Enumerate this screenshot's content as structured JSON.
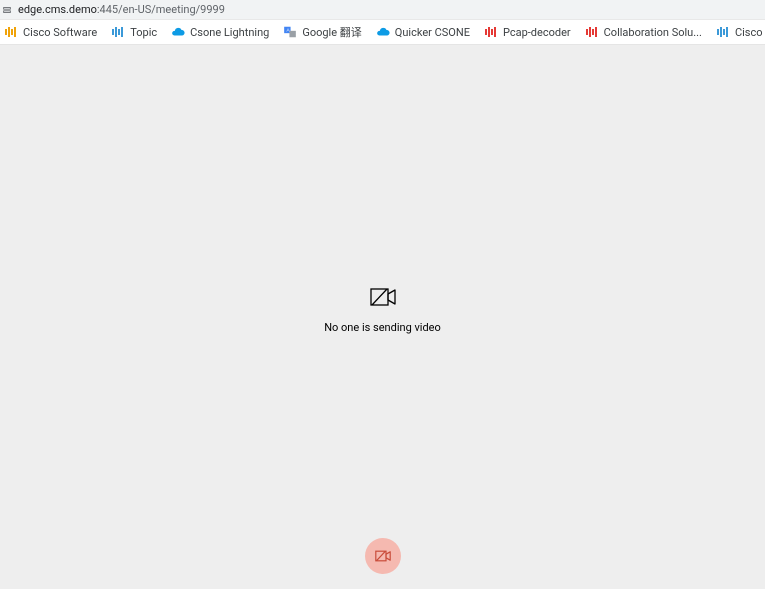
{
  "address": {
    "host": "edge.cms.demo",
    "port_path": ":445/en-US/meeting/9999"
  },
  "bookmarks": [
    {
      "label": "Cisco Software",
      "icon": "grid",
      "color": "#f0a30a"
    },
    {
      "label": "Topic",
      "icon": "grid",
      "color": "#3b99d8"
    },
    {
      "label": "Csone Lightning",
      "icon": "cloud",
      "color": "#0d9be5"
    },
    {
      "label": "Google 翻译",
      "icon": "translate",
      "color": "#4285f4"
    },
    {
      "label": "Quicker CSONE",
      "icon": "cloud",
      "color": "#0d9be5"
    },
    {
      "label": "Pcap-decoder",
      "icon": "grid",
      "color": "#e53935"
    },
    {
      "label": "Collaboration Solu...",
      "icon": "grid",
      "color": "#e53935"
    },
    {
      "label": "Cisco",
      "icon": "grid",
      "color": "#3b99d8"
    }
  ],
  "content": {
    "no_video_text": "No one is sending video"
  },
  "colors": {
    "camera_button_bg": "#f5b9b0",
    "camera_button_icon": "#c94c3a",
    "content_bg": "#eeeeee"
  }
}
